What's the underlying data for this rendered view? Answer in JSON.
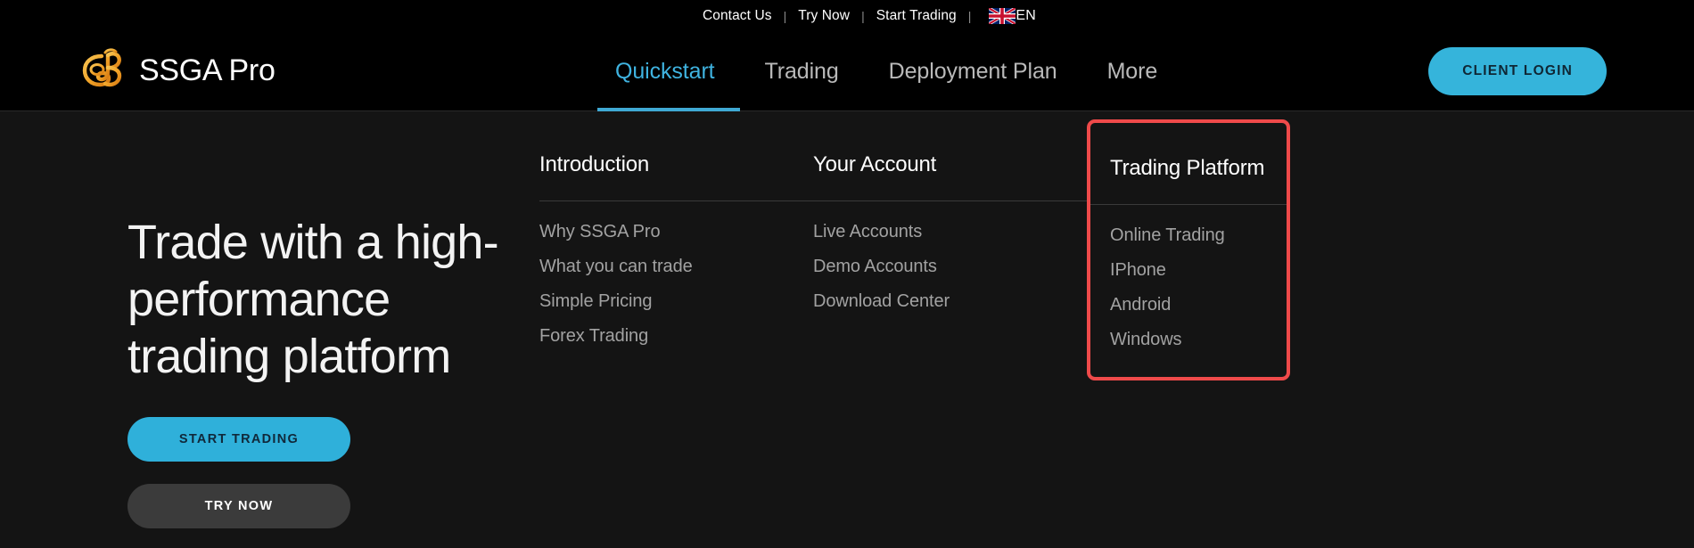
{
  "topbar": {
    "links": [
      {
        "label": "Contact Us"
      },
      {
        "label": "Try Now"
      },
      {
        "label": "Start Trading"
      }
    ],
    "separator": "|",
    "language": {
      "code": "EN",
      "flag_icon": "uk-flag-icon"
    }
  },
  "header": {
    "brand": {
      "name": "SSGA Pro",
      "mark_icon": "ssga-emblem-icon",
      "mark_color": "#f0a227"
    },
    "nav": [
      {
        "label": "Quickstart",
        "active": true
      },
      {
        "label": "Trading",
        "active": false
      },
      {
        "label": "Deployment Plan",
        "active": false
      },
      {
        "label": "More",
        "active": false
      }
    ],
    "client_login_label": "CLIENT LOGIN",
    "accent_color": "#35b4db",
    "active_tab_color": "#3fb3e0"
  },
  "hero": {
    "title": "Trade with a high-performance trading platform",
    "primary_button": "START TRADING",
    "secondary_button": "TRY NOW"
  },
  "megamenu": {
    "columns": [
      {
        "heading": "Introduction",
        "highlighted": false,
        "links": [
          {
            "label": "Why SSGA Pro"
          },
          {
            "label": "What you can trade"
          },
          {
            "label": "Simple Pricing"
          },
          {
            "label": "Forex Trading"
          }
        ]
      },
      {
        "heading": "Your Account",
        "highlighted": false,
        "links": [
          {
            "label": "Live Accounts"
          },
          {
            "label": "Demo Accounts"
          },
          {
            "label": "Download Center"
          }
        ]
      },
      {
        "heading": "Trading Platform",
        "highlighted": true,
        "highlight_color": "#ef4a4a",
        "links": [
          {
            "label": "Online Trading"
          },
          {
            "label": "IPhone"
          },
          {
            "label": "Android"
          },
          {
            "label": "Windows"
          }
        ]
      }
    ]
  }
}
